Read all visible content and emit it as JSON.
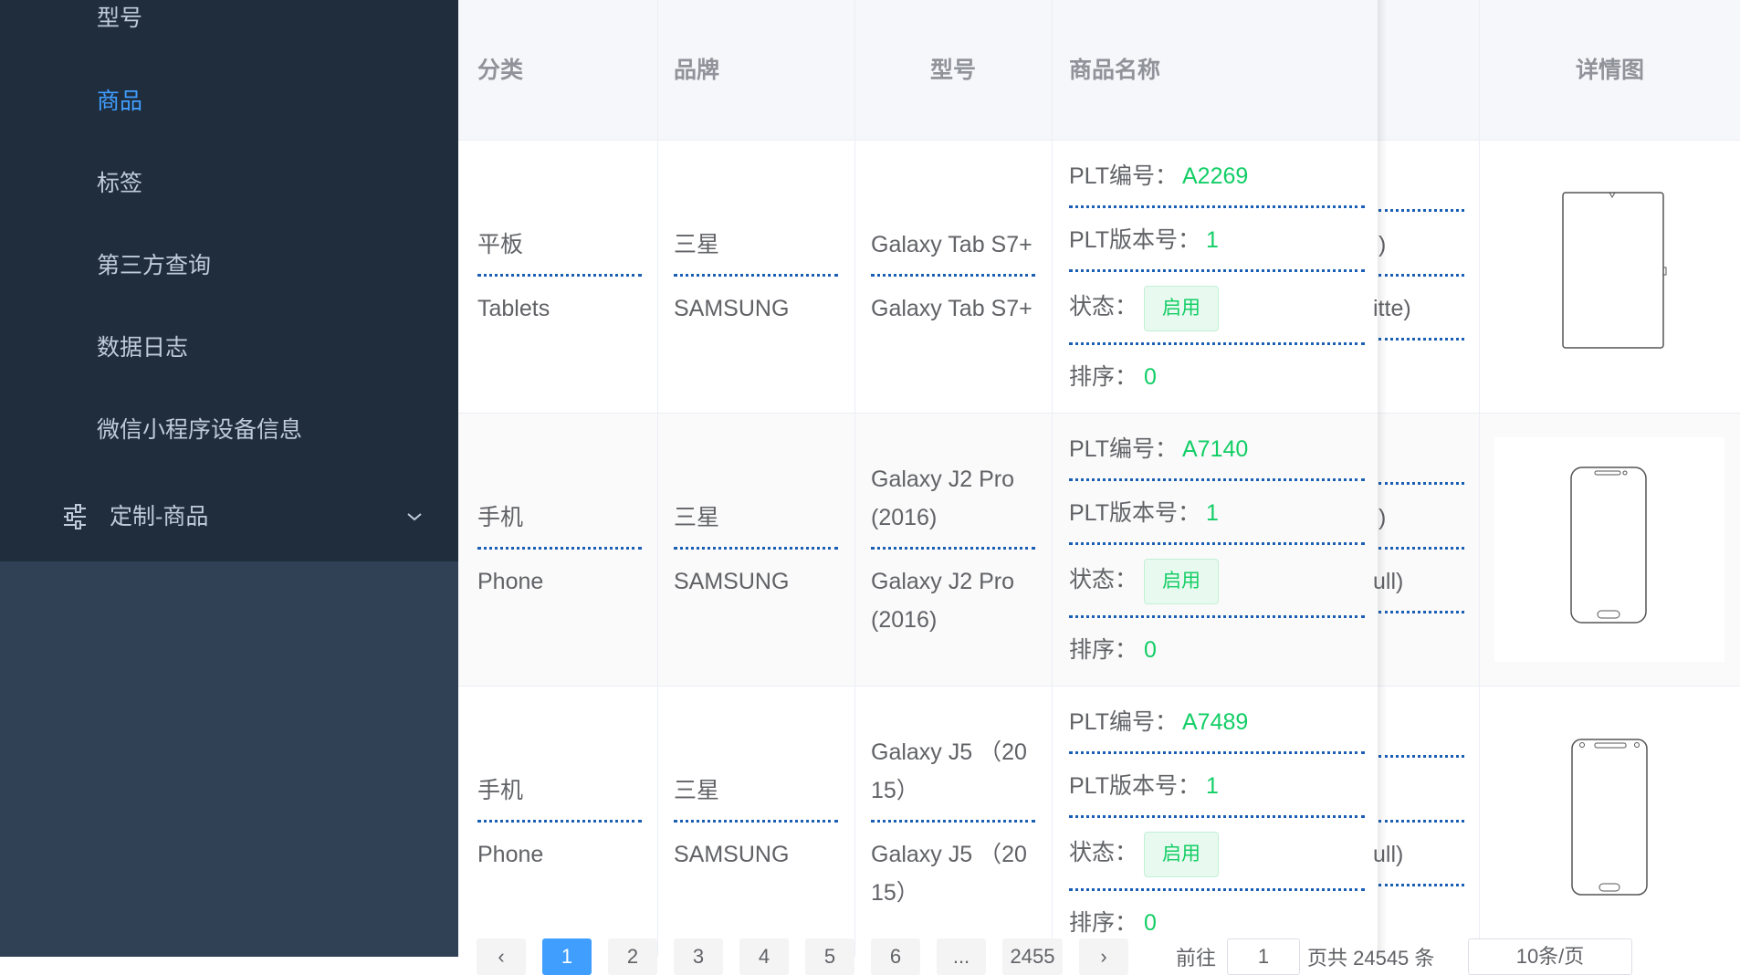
{
  "sidebar": {
    "items": [
      {
        "label": "型号"
      },
      {
        "label": "商品"
      },
      {
        "label": "标签"
      },
      {
        "label": "第三方查询"
      },
      {
        "label": "数据日志"
      },
      {
        "label": "微信小程序设备信息"
      }
    ],
    "submenu": {
      "label": "定制-商品",
      "icon": "sliders-icon"
    }
  },
  "table": {
    "headers": {
      "category": "分类",
      "brand": "品牌",
      "model": "型号",
      "product": "商品名称",
      "detail": "详情图"
    },
    "labels": {
      "plt_code": "PLT编号：",
      "plt_version": "PLT版本号：",
      "status": "状态：",
      "sort": "排序："
    },
    "rows": [
      {
        "category_cn": "平板",
        "category_en": "Tablets",
        "brand_cn": "三星",
        "brand_en": "SAMSUNG",
        "model_a": "Galaxy Tab S7+",
        "model_b": "Galaxy Tab S7+",
        "plt_code": "A2269",
        "plt_version": "1",
        "status": "启用",
        "sort": "0",
        "clip_1": ")",
        "clip_2": "itte)"
      },
      {
        "category_cn": "手机",
        "category_en": "Phone",
        "brand_cn": "三星",
        "brand_en": "SAMSUNG",
        "model_a_1": "Galaxy J2 Pro",
        "model_a_2": "(2016)",
        "model_b_1": "Galaxy J2 Pro",
        "model_b_2": "(2016)",
        "plt_code": "A7140",
        "plt_version": "1",
        "status": "启用",
        "sort": "0",
        "clip_1": ")",
        "clip_2": "ull)"
      },
      {
        "category_cn": "手机",
        "category_en": "Phone",
        "brand_cn": "三星",
        "brand_en": "SAMSUNG",
        "model_a_1": "Galaxy J5 （20",
        "model_a_2": "15）",
        "model_b_1": "Galaxy J5 （20",
        "model_b_2": "15）",
        "plt_code": "A7489",
        "plt_version": "1",
        "status": "启用",
        "sort": "0",
        "clip_2": "ull)"
      }
    ]
  },
  "pagination": {
    "pages": [
      "1",
      "2",
      "3",
      "4",
      "5",
      "6",
      "...",
      "2455"
    ],
    "goto_label": "前往",
    "goto_value": "1",
    "total_text": "页共 24545 条",
    "page_size": "10条/页"
  },
  "colors": {
    "sidebar": "#1f2d3d",
    "sidebar_lower": "#304156",
    "active": "#409eff",
    "success": "#13ce66"
  }
}
